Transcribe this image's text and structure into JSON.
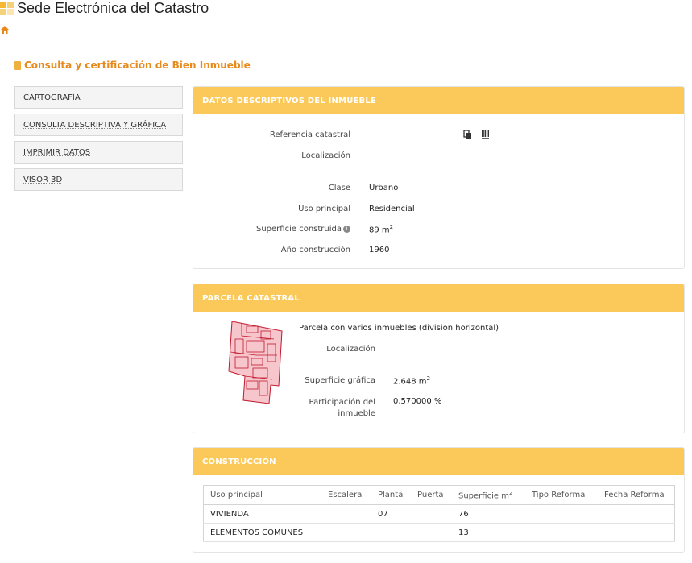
{
  "header": {
    "site_title": "Sede Electrónica del Catastro"
  },
  "page": {
    "title": "Consulta y certificación de Bien Inmueble"
  },
  "sidebar": {
    "items": [
      {
        "label": "CARTOGRAFÍA"
      },
      {
        "label": "CONSULTA DESCRIPTIVA Y GRÁFICA"
      },
      {
        "label": "IMPRIMIR DATOS"
      },
      {
        "label": "VISOR 3D"
      }
    ]
  },
  "datos": {
    "heading": "DATOS DESCRIPTIVOS DEL INMUEBLE",
    "ref_label": "Referencia catastral",
    "loc_label": "Localización",
    "clase_label": "Clase",
    "clase_value": "Urbano",
    "uso_label": "Uso principal",
    "uso_value": "Residencial",
    "sup_label": "Superficie construida",
    "sup_value": "89 m",
    "sup_unit_sup": "2",
    "anio_label": "Año construcción",
    "anio_value": "1960"
  },
  "parcela": {
    "heading": "PARCELA CATASTRAL",
    "desc": "Parcela con varios inmuebles (division horizontal)",
    "loc_label": "Localización",
    "supg_label": "Superficie gráfica",
    "supg_value": "2.648 m",
    "supg_sup": "2",
    "part_label_1": "Participación del",
    "part_label_2": "inmueble",
    "part_value": "0,570000 %"
  },
  "construccion": {
    "heading": "CONSTRUCCIÓN",
    "columns": [
      "Uso principal",
      "Escalera",
      "Planta",
      "Puerta",
      "Superficie m",
      "Tipo Reforma",
      "Fecha Reforma"
    ],
    "sup_col_sup": "2",
    "rows": [
      [
        "VIVIENDA",
        "",
        "07",
        "",
        "76",
        "",
        ""
      ],
      [
        "ELEMENTOS COMUNES",
        "",
        "",
        "",
        "13",
        "",
        ""
      ]
    ]
  },
  "colors": {
    "accent": "#e8891b",
    "panel_header": "#fbc959",
    "parcel_fill": "#f6c6cc",
    "parcel_stroke": "#c0182d"
  }
}
